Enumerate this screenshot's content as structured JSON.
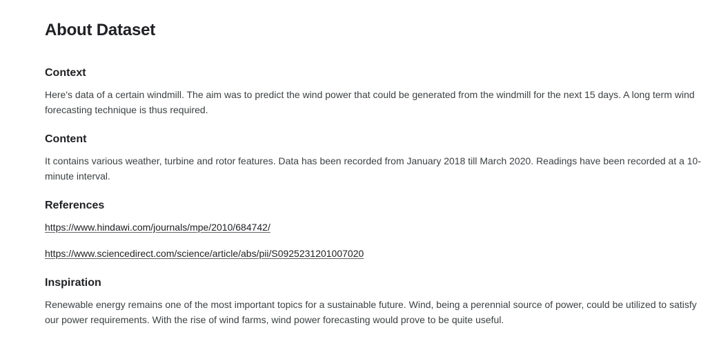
{
  "title": "About Dataset",
  "sections": {
    "context": {
      "heading": "Context",
      "body": "Here's data of a certain windmill. The aim was to predict the wind power that could be generated from the windmill for the next 15 days. A long term wind forecasting technique is thus required."
    },
    "content": {
      "heading": "Content",
      "body": "It contains various weather, turbine and rotor features. Data has been recorded from January 2018 till March 2020. Readings have been recorded at a 10-minute interval."
    },
    "references": {
      "heading": "References",
      "links": [
        "https://www.hindawi.com/journals/mpe/2010/684742/",
        "https://www.sciencedirect.com/science/article/abs/pii/S0925231201007020"
      ]
    },
    "inspiration": {
      "heading": "Inspiration",
      "body": "Renewable energy remains one of the most important topics for a sustainable future. Wind, being a perennial source of power, could be utilized to satisfy our power requirements. With the rise of wind farms, wind power forecasting would prove to be quite useful."
    }
  }
}
